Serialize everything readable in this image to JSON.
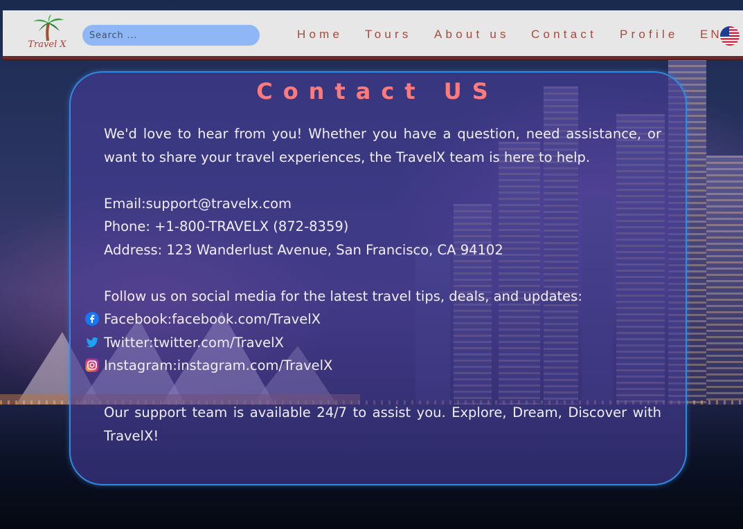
{
  "brand": {
    "logo_text": "Travel X"
  },
  "search": {
    "placeholder": "Search ..."
  },
  "nav": {
    "items": [
      {
        "label": "Home"
      },
      {
        "label": "Tours"
      },
      {
        "label": "About us"
      },
      {
        "label": "Contact"
      },
      {
        "label": "Profile"
      }
    ],
    "language": "EN",
    "flag_icon": "us-flag-icon"
  },
  "contact": {
    "title": "Contact US",
    "intro": "We'd love to hear from you! Whether you have a question, need assistance, or want to share your travel experiences, the TravelX team is here to help.",
    "email": "Email:support@travelx.com",
    "phone": "Phone: +1-800-TRAVELX (872-8359)",
    "address": "Address: 123 Wanderlust Avenue, San Francisco, CA 94102",
    "social_intro": "Follow us on social media for the latest travel tips, deals, and updates:",
    "social": [
      {
        "label": "Facebook:facebook.com/TravelX",
        "icon": "facebook-icon"
      },
      {
        "label": "Twitter:twitter.com/TravelX",
        "icon": "twitter-icon"
      },
      {
        "label": "Instagram:instagram.com/TravelX",
        "icon": "instagram-icon"
      }
    ],
    "closing": "Our support team is available 24/7 to assist you. Explore, Dream, Discover with TravelX!"
  },
  "colors": {
    "nav_text": "#a24b3c",
    "title": "#ff7b7b",
    "card_border": "#2f8be0",
    "search_bg": "#8fb6f5",
    "topbar_border": "#6e2a2a"
  }
}
